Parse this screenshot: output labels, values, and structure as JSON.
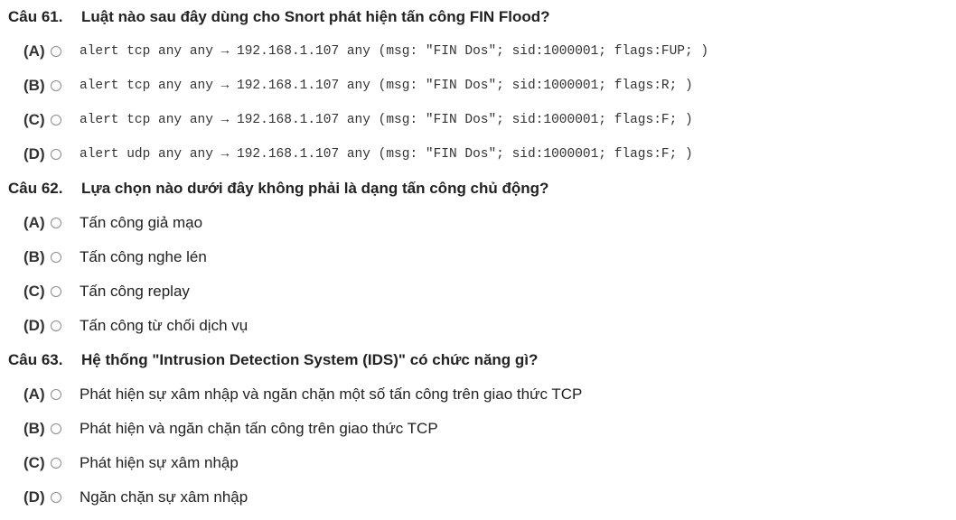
{
  "questions": [
    {
      "number": "Câu 61.",
      "text": "Luật nào sau đây dùng cho Snort phát hiện tấn công FIN Flood?",
      "monospace": true,
      "options": [
        {
          "letter": "(A)",
          "text": "alert tcp any any → 192.168.1.107 any (msg: \"FIN Dos\"; sid:1000001; flags:FUP; )"
        },
        {
          "letter": "(B)",
          "text": "alert tcp any any → 192.168.1.107 any (msg: \"FIN Dos\"; sid:1000001; flags:R; )"
        },
        {
          "letter": "(C)",
          "text": "alert tcp any any → 192.168.1.107 any (msg: \"FIN Dos\"; sid:1000001; flags:F; )"
        },
        {
          "letter": "(D)",
          "text": "alert udp any any → 192.168.1.107 any (msg: \"FIN Dos\"; sid:1000001; flags:F; )"
        }
      ]
    },
    {
      "number": "Câu 62.",
      "text": "Lựa chọn nào dưới đây không phải là dạng tấn công chủ động?",
      "monospace": false,
      "options": [
        {
          "letter": "(A)",
          "text": "Tấn công giả mạo"
        },
        {
          "letter": "(B)",
          "text": "Tấn công nghe lén"
        },
        {
          "letter": "(C)",
          "text": "Tấn công replay"
        },
        {
          "letter": "(D)",
          "text": "Tấn công từ chối dịch vụ"
        }
      ]
    },
    {
      "number": "Câu 63.",
      "text": "Hệ thống \"Intrusion Detection System (IDS)\" có chức năng gì?",
      "monospace": false,
      "options": [
        {
          "letter": "(A)",
          "text": "Phát hiện sự xâm nhập và ngăn chặn một số tấn công trên giao thức TCP"
        },
        {
          "letter": "(B)",
          "text": "Phát hiện và ngăn chặn tấn công trên giao thức TCP"
        },
        {
          "letter": "(C)",
          "text": "Phát hiện sự xâm nhập"
        },
        {
          "letter": "(D)",
          "text": "Ngăn chặn sự xâm nhập"
        }
      ]
    }
  ]
}
